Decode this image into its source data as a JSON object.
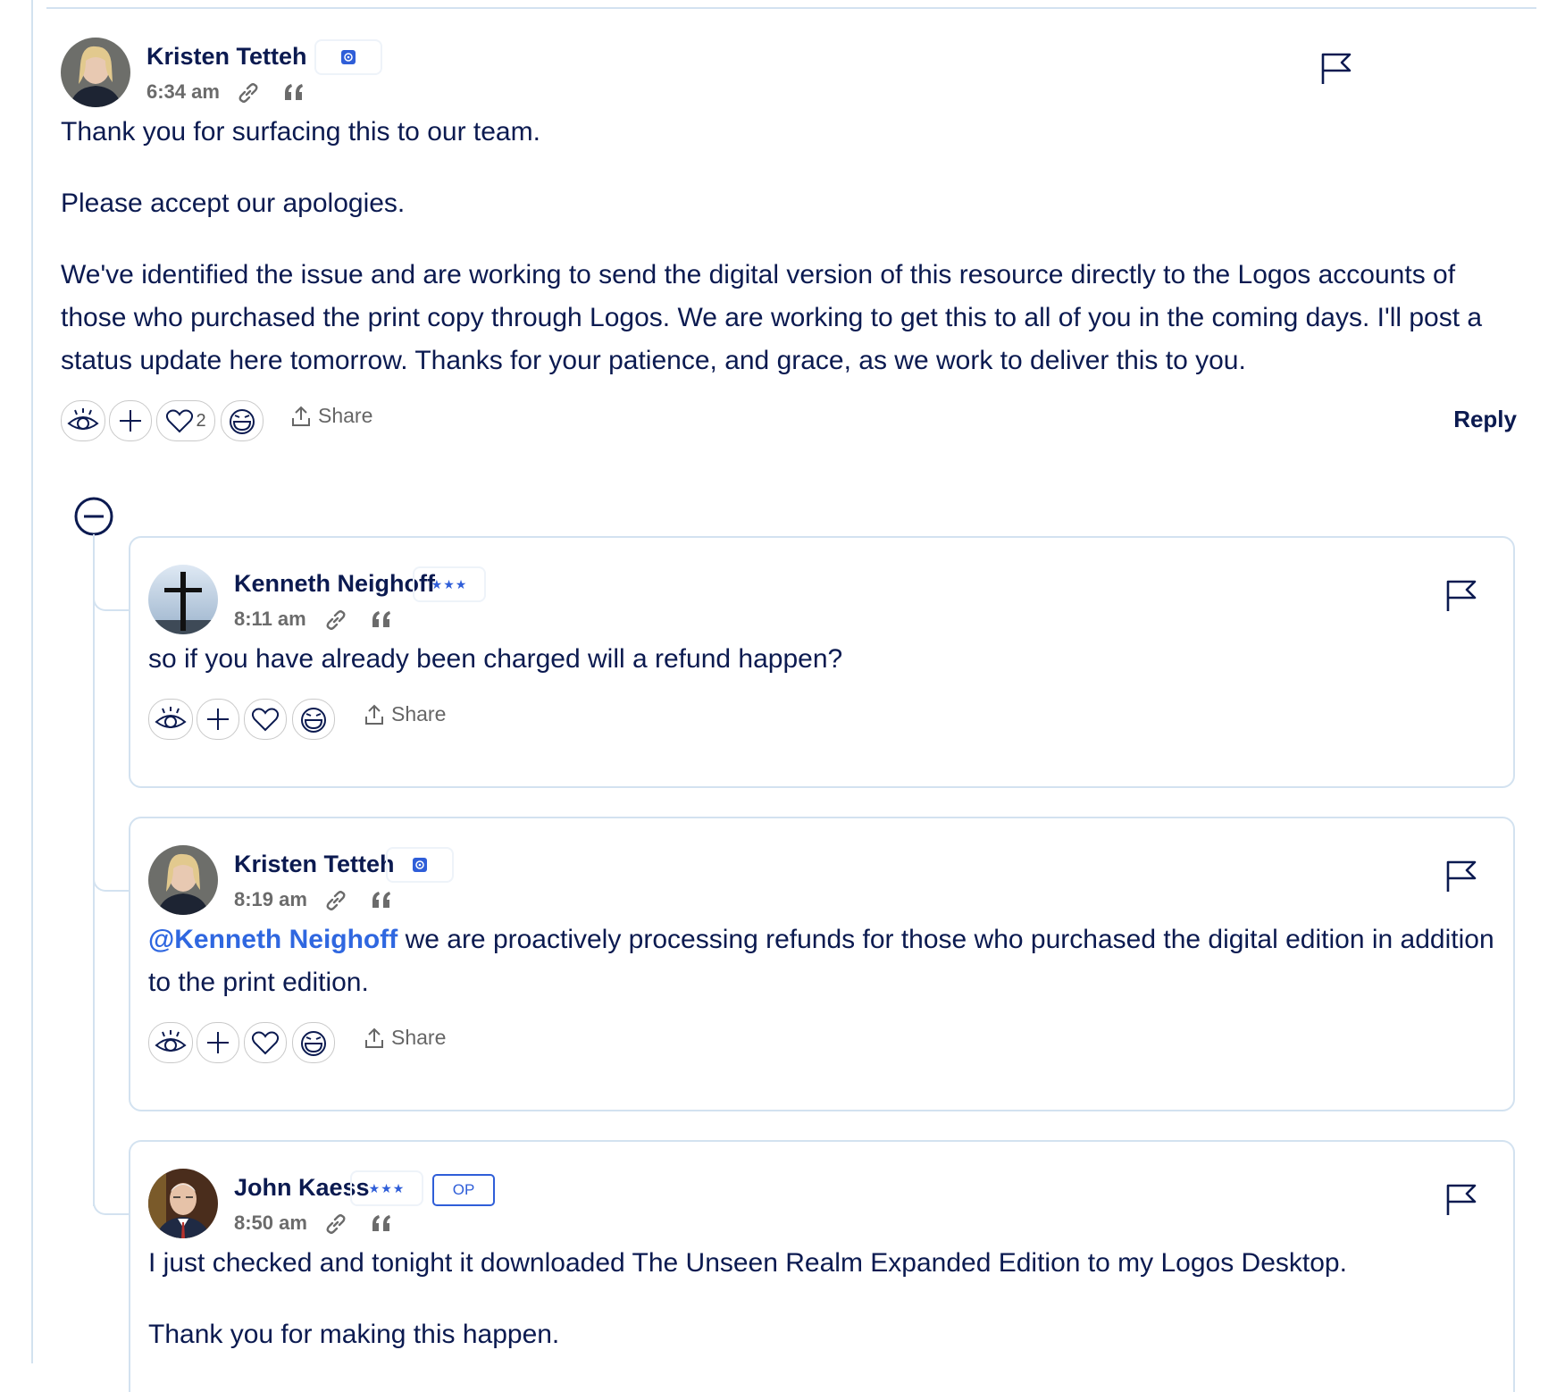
{
  "colors": {
    "accent": "#2f5ed8",
    "text": "#0b1a50",
    "muted": "#6b6b6b",
    "border": "#d3e2f0"
  },
  "main": {
    "author": "Kristen Tetteh",
    "badge_icon": "staff-badge-icon",
    "time": "6:34 am",
    "paragraphs": [
      "Thank you for surfacing this to our team.",
      "Please accept our apologies.",
      "We've identified the issue and are working to send the digital version of this resource directly to the Logos accounts of those who purchased the print copy through Logos. We are working to get this to all of you in the coming days. I'll post a status update here tomorrow. Thanks for your patience, and grace, as we work to deliver this to you."
    ],
    "heart_count": "2",
    "share_label": "Share",
    "reply_label": "Reply"
  },
  "replies": [
    {
      "author": "Kenneth Neighoff",
      "badge": "★★★",
      "time": "8:11 am",
      "mention": "",
      "text": "so if you have already been charged will a refund happen?",
      "share_label": "Share"
    },
    {
      "author": "Kristen Tetteh",
      "badge_icon": "staff-badge-icon",
      "time": "8:19 am",
      "mention": "@Kenneth Neighoff",
      "text": " we are proactively processing refunds for those who purchased the digital edition in addition to the print edition.",
      "share_label": "Share"
    },
    {
      "author": "John Kaess",
      "badge": "★★★",
      "op_label": "OP",
      "time": "8:50 am",
      "text": "I just checked and tonight it downloaded The Unseen Realm Expanded Edition to my Logos Desktop.",
      "text2": "Thank you for making this happen."
    }
  ]
}
